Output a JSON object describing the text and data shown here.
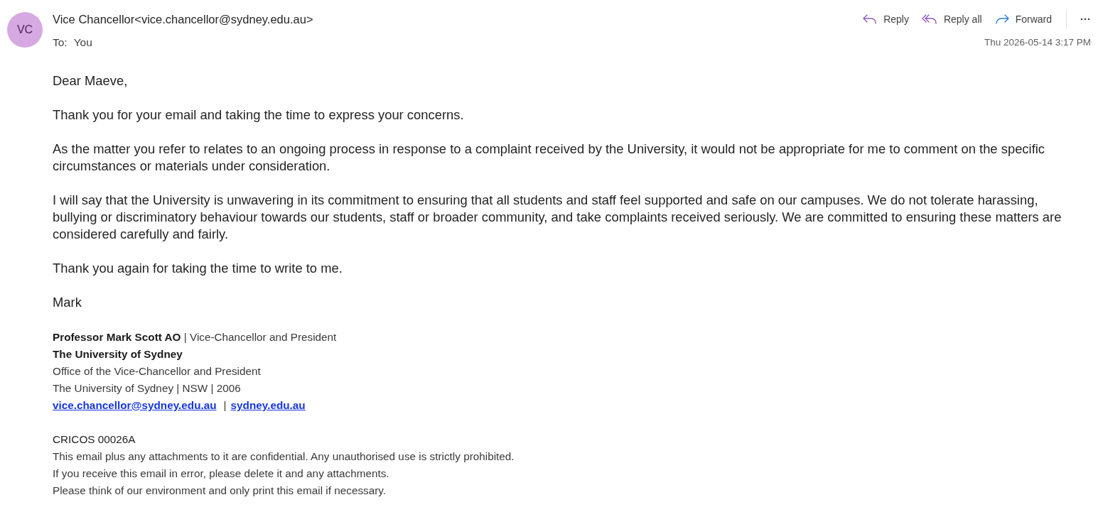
{
  "message_header": {
    "avatar_initials": "VC",
    "sender": "Vice Chancellor<vice.chancellor@sydney.edu.au>",
    "to_label": "To:",
    "recipient": "You",
    "date": "Thu 2026-05-14 3:17 PM"
  },
  "actions": [
    {
      "kind": "reply",
      "label": "Reply"
    },
    {
      "kind": "reply_all",
      "label": "Reply all"
    },
    {
      "kind": "forward",
      "label": "Forward"
    },
    {
      "kind": "more"
    }
  ],
  "body": {
    "paragraphs": [
      "Dear Maeve,",
      "Thank you for your email and taking the time to express your concerns.",
      "As the matter you refer to relates to an ongoing process in response to a complaint received by the University, it would not be appropriate for me to comment on the specific circumstances or materials under consideration.",
      "I will say that the University is unwavering in its commitment to ensuring that all students and staff feel supported and safe on our campuses. We do not tolerate harassing, bullying or discriminatory behaviour towards our students, staff or broader community, and take complaints received seriously. We are committed to ensuring these matters are considered carefully and fairly.",
      "Thank you again for taking the time to write to me.",
      "Mark"
    ],
    "signature": {
      "title_line": "**Professor Mark Scott AO** | Vice-Chancellor and President",
      "organisation": "The University of Sydney",
      "address_lines": [
        "Office of the Vice-Chancellor and President",
        "The University of Sydney | NSW | 2006"
      ],
      "links": [
        "vice.chancellor@sydney.edu.au",
        "sydney.edu.au"
      ],
      "link_separator": "|"
    },
    "disclaimer": [
      "CRICOS 00026A",
      "This email plus any attachments to it are confidential. Any unauthorised use is strictly prohibited.",
      "If you receive this email in error, please delete it and any attachments.",
      "Please think of our environment and only print this email if necessary."
    ]
  }
}
